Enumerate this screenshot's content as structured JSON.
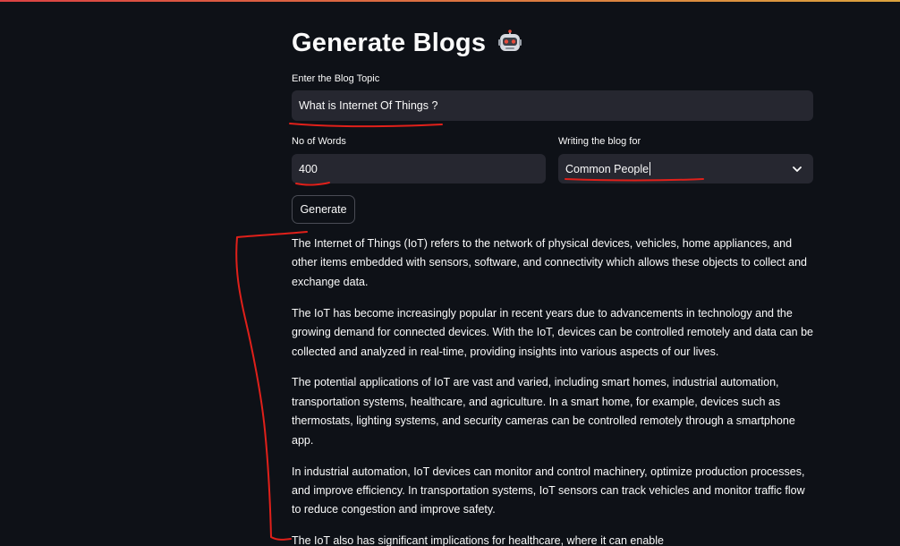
{
  "title": "Generate Blogs",
  "topic": {
    "label": "Enter the Blog Topic",
    "value": "What is Internet Of Things ?"
  },
  "words": {
    "label": "No of Words",
    "value": "400"
  },
  "audience": {
    "label": "Writing the blog for",
    "value": "Common People"
  },
  "generate_button": "Generate",
  "output": {
    "paragraphs": [
      "The Internet of Things (IoT) refers to the network of physical devices, vehicles, home appliances, and other items embedded with sensors, software, and connectivity which allows these objects to collect and exchange data.",
      "The IoT has become increasingly popular in recent years due to advancements in technology and the growing demand for connected devices. With the IoT, devices can be controlled remotely and data can be collected and analyzed in real-time, providing insights into various aspects of our lives.",
      "The potential applications of IoT are vast and varied, including smart homes, industrial automation, transportation systems, healthcare, and agriculture. In a smart home, for example, devices such as thermostats, lighting systems, and security cameras can be controlled remotely through a smartphone app.",
      "In industrial automation, IoT devices can monitor and control machinery, optimize production processes, and improve efficiency. In transportation systems, IoT sensors can track vehicles and monitor traffic flow to reduce congestion and improve safety.",
      "The IoT also has significant implications for healthcare, where it can enable"
    ]
  },
  "colors": {
    "background": "#0e1117",
    "input_background": "#262730",
    "text": "#fafafa",
    "annotation": "#e0201a"
  },
  "icons": {
    "title_emoji": "robot-icon",
    "select_caret": "chevron-down-icon"
  }
}
